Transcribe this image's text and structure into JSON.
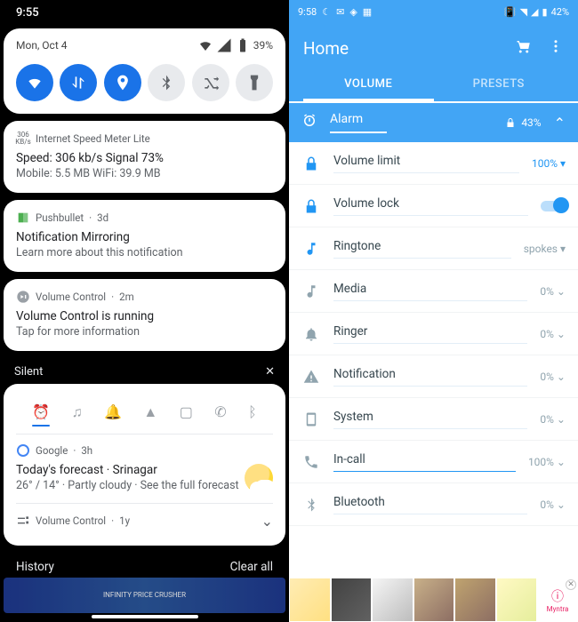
{
  "left": {
    "status_time": "9:55",
    "panel": {
      "date": "Mon, Oct 4",
      "battery": "39%"
    },
    "qs": [
      {
        "name": "wifi",
        "on": true
      },
      {
        "name": "data",
        "on": true
      },
      {
        "name": "location",
        "on": true
      },
      {
        "name": "bluetooth",
        "on": false
      },
      {
        "name": "shuffle",
        "on": false
      },
      {
        "name": "flashlight",
        "on": false
      }
    ],
    "notifications": [
      {
        "app": "Internet Speed Meter Lite",
        "icon": "306 KB/s",
        "title": "Speed: 306 kb/s    Signal 73%",
        "body": "Mobile: 5.5 MB   WiFi: 39.9 MB"
      },
      {
        "app": "Pushbullet",
        "time": "3d",
        "title": "Notification Mirroring",
        "body": "Learn more about this notification"
      },
      {
        "app": "Volume Control",
        "time": "2m",
        "title": "Volume Control is running",
        "body": "Tap for more information"
      }
    ],
    "silent_label": "Silent",
    "vc_icons": [
      "alarm",
      "music",
      "bell",
      "alert",
      "phone",
      "call",
      "bluetooth"
    ],
    "weather": {
      "app": "Google",
      "time": "3h",
      "title": "Today's forecast · Srinagar",
      "body": "26° / 14° · Partly cloudy · See the full forecast"
    },
    "vc_footer": {
      "app": "Volume Control",
      "time": "1y"
    },
    "history": "History",
    "clear_all": "Clear all"
  },
  "right": {
    "status": {
      "time": "9:58",
      "battery": "42%"
    },
    "title": "Home",
    "tabs": [
      "VOLUME",
      "PRESETS"
    ],
    "main": {
      "label": "Alarm",
      "value": "43%"
    },
    "rows": [
      {
        "icon": "lock",
        "blue": true,
        "label": "Volume limit",
        "value": "100%",
        "valblue": true,
        "chev": "▾",
        "full": false
      },
      {
        "icon": "lock",
        "blue": true,
        "label": "Volume lock",
        "toggle": true,
        "full": false
      },
      {
        "icon": "music",
        "blue": true,
        "label": "Ringtone",
        "value": "spokes",
        "chev": "▾",
        "full": false
      },
      {
        "icon": "music",
        "blue": false,
        "label": "Media",
        "value": "0%",
        "chev": "⌄",
        "full": false
      },
      {
        "icon": "bell",
        "blue": false,
        "label": "Ringer",
        "value": "0%",
        "chev": "⌄",
        "full": false
      },
      {
        "icon": "alert",
        "blue": false,
        "label": "Notification",
        "value": "0%",
        "chev": "⌄",
        "full": false
      },
      {
        "icon": "phone",
        "blue": false,
        "label": "System",
        "value": "0%",
        "chev": "⌄",
        "full": false
      },
      {
        "icon": "call",
        "blue": false,
        "label": "In-call",
        "value": "100%",
        "chev": "⌄",
        "full": true
      },
      {
        "icon": "bluetooth",
        "blue": false,
        "label": "Bluetooth",
        "value": "0%",
        "chev": "⌄",
        "full": false
      }
    ],
    "ad_brand": "Myntra"
  }
}
